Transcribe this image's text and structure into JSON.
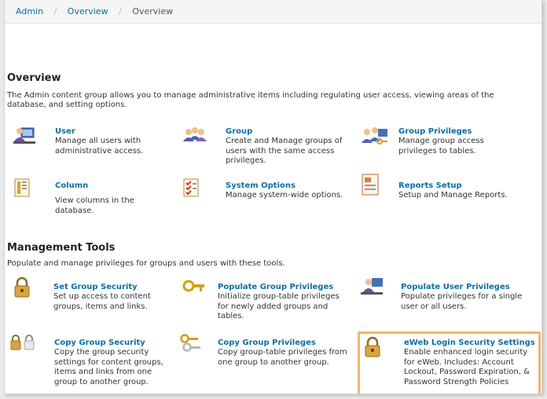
{
  "breadcrumb": [
    "Admin",
    "Overview",
    "Overview"
  ],
  "overview": {
    "title": "Overview",
    "description": "The Admin content group allows you to manage administrative items including regulating user access, viewing areas of the database, and setting options.",
    "items": [
      {
        "title": "User",
        "description": "Manage all users with administrative access.",
        "icon": "user-icon"
      },
      {
        "title": "Group",
        "description": "Create and Manage groups of users with the same access privileges.",
        "icon": "group-icon"
      },
      {
        "title": "Group Privileges",
        "description": "Manage group access privileges to tables.",
        "icon": "group-privileges-icon"
      },
      {
        "title": "Column",
        "description": "View columns in the database.",
        "icon": "column-icon"
      },
      {
        "title": "System Options",
        "description": "Manage system-wide options.",
        "icon": "system-options-icon"
      },
      {
        "title": "Reports Setup",
        "description": "Setup and Manage Reports.",
        "icon": "reports-setup-icon"
      }
    ]
  },
  "management": {
    "title": "Management Tools",
    "description": "Populate and manage privileges for groups and users with these tools.",
    "items": [
      {
        "title": "Set Group Security",
        "description": "Set up access to content groups, items and links.",
        "icon": "padlock-icon"
      },
      {
        "title": "Populate Group Privileges",
        "description": "Initialize group-table privileges for newly added groups and tables.",
        "icon": "key-icon"
      },
      {
        "title": "Populate User Privileges",
        "description": "Populate privileges for a single user or all users.",
        "icon": "user-privileges-icon"
      },
      {
        "title": "Copy Group Security",
        "description": "Copy the group security settings for content groups, items and links from one group to another group.",
        "icon": "copy-padlock-icon"
      },
      {
        "title": "Copy Group Privileges",
        "description": "Copy group-table privileges from one group to another group.",
        "icon": "copy-keys-icon"
      },
      {
        "title": "eWeb Login Security Settings",
        "description": "Enable enhanced login security for eWeb. Includes: Account Lockout, Password Expiration, & Password Strength Policies",
        "icon": "login-padlock-icon"
      }
    ]
  },
  "colors": {
    "link": "#0b6fa4",
    "highlight": "#f3b56c"
  }
}
